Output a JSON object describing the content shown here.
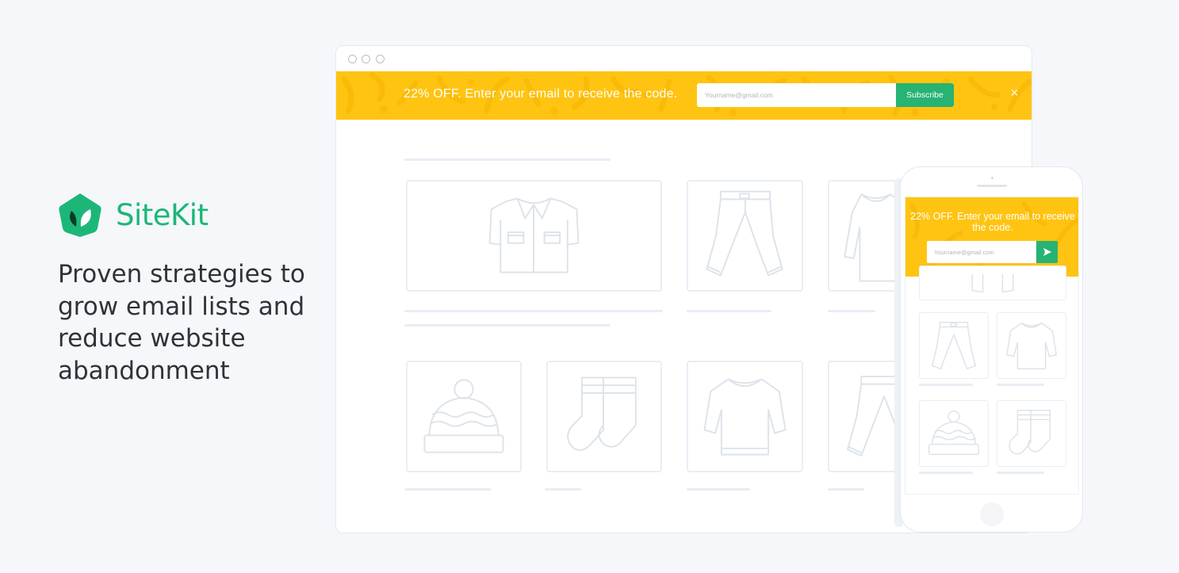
{
  "brand": {
    "name": "SiteKit",
    "color": "#1cb778",
    "logo_icon": "leaf-shield-icon"
  },
  "tagline": "Proven strategies to grow email lists and reduce website abandonment",
  "desktop": {
    "banner": {
      "text": "22% OFF. Enter your email to receive the code.",
      "email_placeholder": "Yourname@gmail.com",
      "subscribe_label": "Subscribe",
      "close_label": "×",
      "background": "#ffc411",
      "button_color": "#27b374"
    },
    "products": [
      "jacket-icon",
      "pants-icon",
      "sweater-icon",
      "beanie-icon",
      "socks-icon",
      "sweater-icon",
      "pants-icon"
    ]
  },
  "mobile": {
    "banner": {
      "text": "22% OFF. Enter your email to receive the code.",
      "email_placeholder": "Yourname@gmail.com",
      "send_icon": "send-arrow-icon"
    },
    "products": [
      "pants-icon",
      "pants-icon",
      "sweater-icon",
      "beanie-icon",
      "socks-icon"
    ]
  }
}
